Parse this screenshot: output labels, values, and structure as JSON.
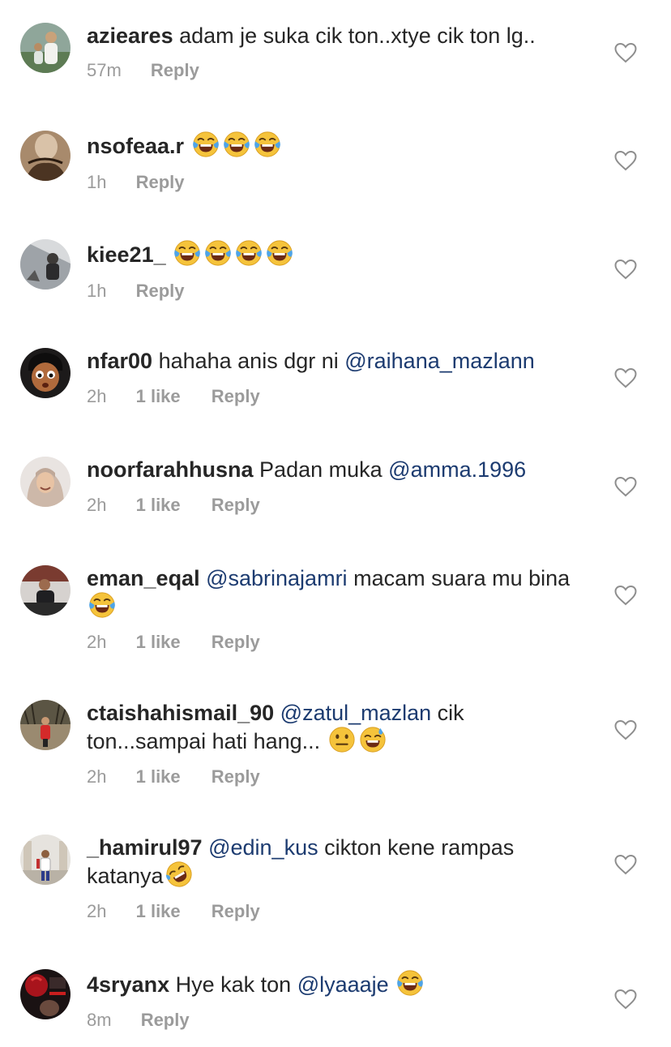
{
  "colors": {
    "text": "#262626",
    "meta": "#9b9b9b",
    "mention": "#1c3b70",
    "heart_stroke": "#8e8e8e",
    "emoji_face": "#f5c33b"
  },
  "icons": {
    "like": "heart-outline-icon",
    "laugh": "face-with-tears-of-joy-emoji",
    "rofl": "rolling-on-the-floor-laughing-emoji",
    "neutral": "neutral-face-emoji",
    "sweat": "grinning-face-with-sweat-emoji"
  },
  "comments": [
    {
      "username": "azieares",
      "text": "adam je suka cik ton..xtye cik ton lg..",
      "time": "57m",
      "reply": "Reply"
    },
    {
      "username": "nsofeaa.r",
      "emojis": [
        "face-with-tears-of-joy-emoji",
        "face-with-tears-of-joy-emoji",
        "face-with-tears-of-joy-emoji"
      ],
      "time": "1h",
      "reply": "Reply"
    },
    {
      "username": "kiee21_",
      "emojis": [
        "face-with-tears-of-joy-emoji",
        "face-with-tears-of-joy-emoji",
        "face-with-tears-of-joy-emoji",
        "face-with-tears-of-joy-emoji"
      ],
      "time": "1h",
      "reply": "Reply"
    },
    {
      "username": "nfar00",
      "text": "hahaha anis dgr ni",
      "mention": "@raihana_mazlann",
      "time": "2h",
      "likes": "1 like",
      "reply": "Reply"
    },
    {
      "username": "noorfarahhusna",
      "text": "Padan muka",
      "mention": "@amma.1996",
      "time": "2h",
      "likes": "1 like",
      "reply": "Reply"
    },
    {
      "username": "eman_eqal",
      "mention": "@sabrinajamri",
      "text": "macam suara mu bina",
      "time": "2h",
      "likes": "1 like",
      "reply": "Reply"
    },
    {
      "username": "ctaishahismail_90",
      "mention": "@zatul_mazlan",
      "text": "cik ton...sampai hati hang...",
      "time": "2h",
      "likes": "1 like",
      "reply": "Reply"
    },
    {
      "username": "_hamirul97",
      "mention": "@edin_kus",
      "text": "cikton kene rampas katanya",
      "time": "2h",
      "likes": "1 like",
      "reply": "Reply"
    },
    {
      "username": "4sryanx",
      "text": "Hye kak ton",
      "mention": "@lyaaaje",
      "time": "8m",
      "reply": "Reply"
    }
  ]
}
